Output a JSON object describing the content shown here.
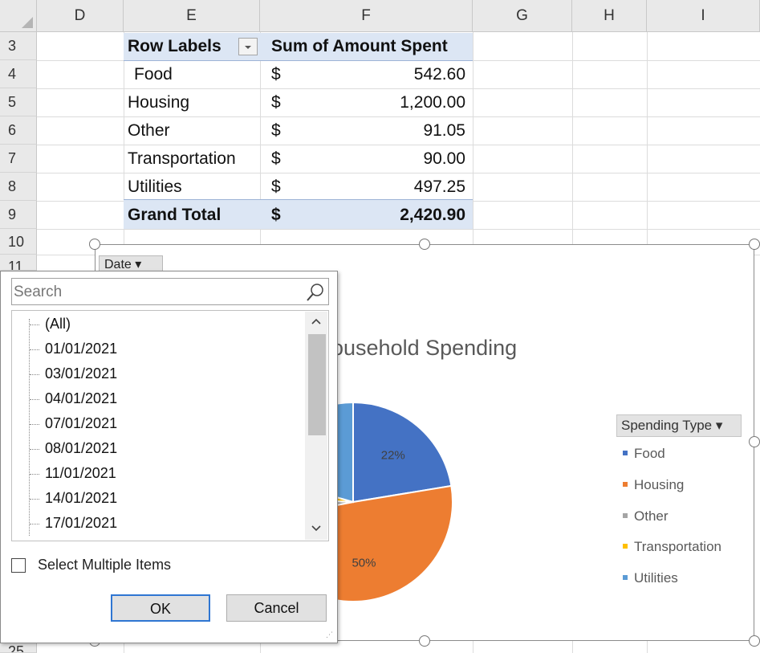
{
  "columns": [
    "D",
    "E",
    "F",
    "G",
    "H",
    "I"
  ],
  "rows": [
    "3",
    "4",
    "5",
    "6",
    "7",
    "8",
    "9",
    "10",
    "11",
    "25"
  ],
  "pivot": {
    "header_labels": "Row Labels",
    "header_values": "Sum of Amount Spent",
    "currency": "$",
    "rows": [
      {
        "label": "Food",
        "value": "542.60"
      },
      {
        "label": "Housing",
        "value": "1,200.00"
      },
      {
        "label": "Other",
        "value": "91.05"
      },
      {
        "label": "Transportation",
        "value": "90.00"
      },
      {
        "label": "Utilities",
        "value": "497.25"
      }
    ],
    "total_label": "Grand Total",
    "total_value": "2,420.90"
  },
  "chart": {
    "title": "ousehold Spending",
    "date_filter_button": "Date ▾",
    "legend_button": "Spending Type ▾",
    "legend": [
      {
        "name": "Food",
        "color": "#4472c4"
      },
      {
        "name": "Housing",
        "color": "#ed7d31"
      },
      {
        "name": "Other",
        "color": "#a5a5a5"
      },
      {
        "name": "Transportation",
        "color": "#ffc000"
      },
      {
        "name": "Utilities",
        "color": "#5b9bd5"
      }
    ],
    "slice_labels": [
      "22%",
      "50%"
    ]
  },
  "chart_data": {
    "type": "pie",
    "title": "Household Spending",
    "categories": [
      "Food",
      "Housing",
      "Other",
      "Transportation",
      "Utilities"
    ],
    "values": [
      542.6,
      1200.0,
      91.05,
      90.0,
      497.25
    ],
    "percent_labels": {
      "Food": "22%",
      "Housing": "50%"
    },
    "legend_title": "Spending Type",
    "legend_position": "right"
  },
  "filter_dropdown": {
    "search_placeholder": "Search",
    "items": [
      "(All)",
      "01/01/2021",
      "03/01/2021",
      "04/01/2021",
      "07/01/2021",
      "08/01/2021",
      "11/01/2021",
      "14/01/2021",
      "17/01/2021"
    ],
    "select_multiple_label": "Select Multiple Items",
    "ok_label": "OK",
    "cancel_label": "Cancel"
  }
}
